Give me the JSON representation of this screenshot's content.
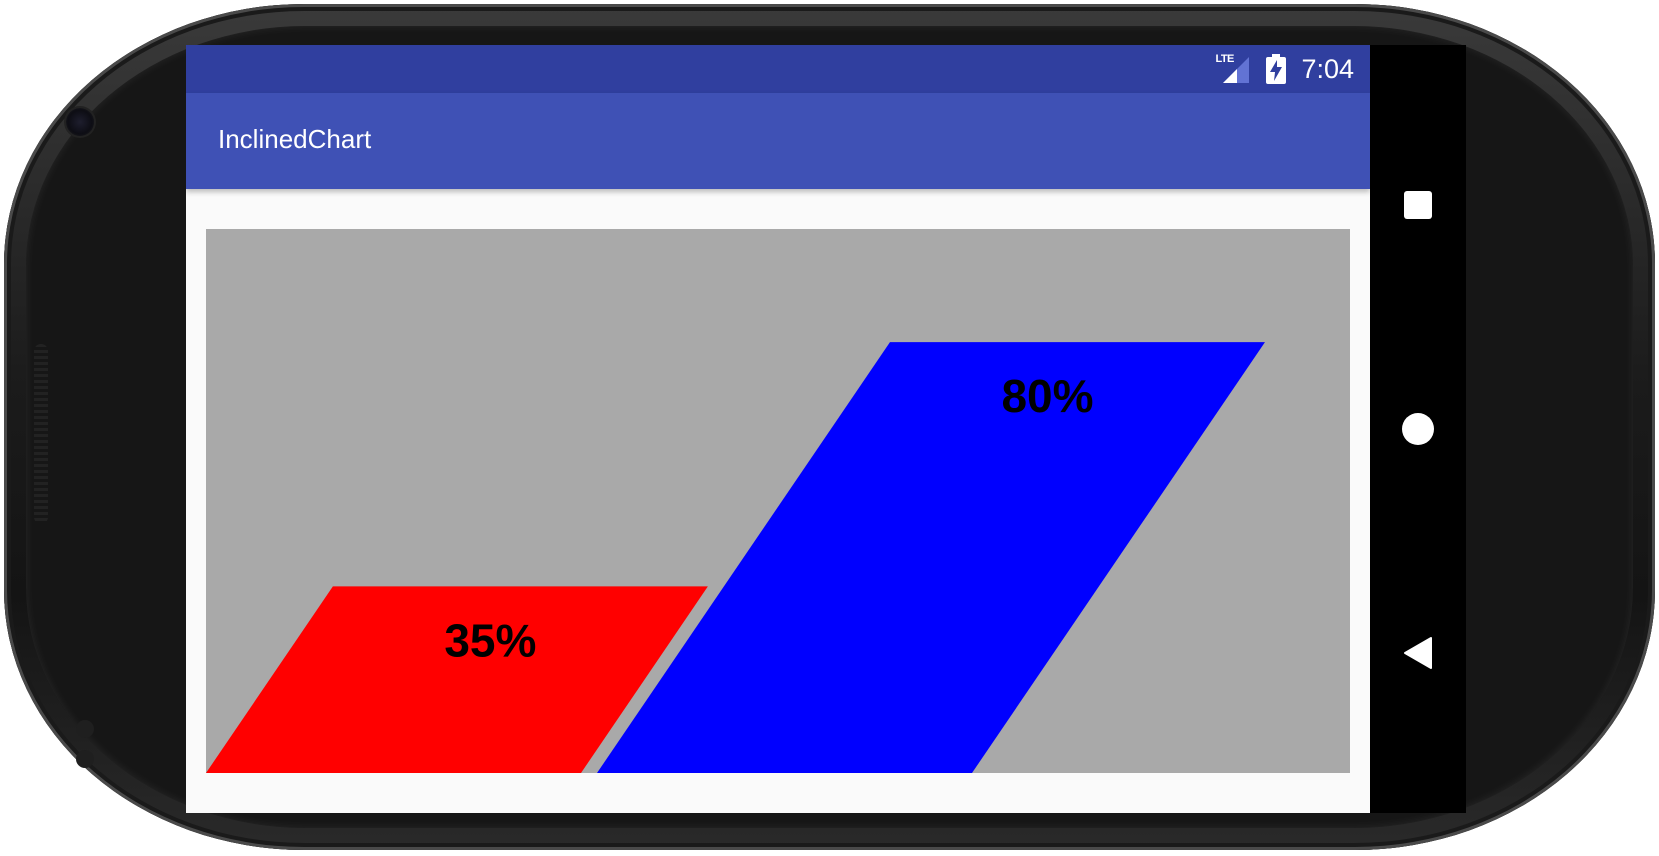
{
  "status_bar": {
    "network_label": "LTE",
    "time": "7:04"
  },
  "toolbar": {
    "title": "InclinedChart"
  },
  "chart_data": {
    "type": "bar",
    "values": [
      35,
      80
    ],
    "labels": [
      "35%",
      "80%"
    ],
    "colors": [
      "#ff0000",
      "#0000ff"
    ],
    "background": "#a9a9a9",
    "ylim": [
      0,
      100
    ]
  },
  "nav_bar": {
    "recents_icon": "square-icon",
    "home_icon": "circle-icon",
    "back_icon": "triangle-back-icon"
  },
  "colors": {
    "status_bar": "#303f9f",
    "toolbar": "#3f51b5"
  }
}
